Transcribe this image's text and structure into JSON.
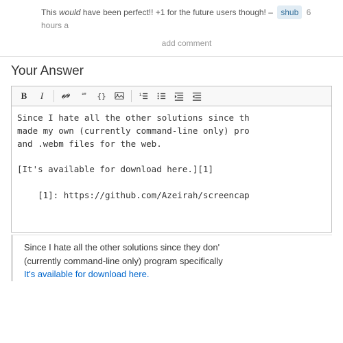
{
  "comment": {
    "text_prefix": "This ",
    "text_italic": "would",
    "text_suffix": " have been perfect!! +1 for the future users though! –",
    "username": "shub",
    "time": "6 hours a",
    "add_comment_label": "add comment"
  },
  "answer_section": {
    "title": "Your Answer",
    "toolbar": {
      "bold_label": "B",
      "italic_label": "I",
      "buttons": [
        "B",
        "I",
        "🔗",
        "\"\"",
        "{}",
        "🖼",
        "1.",
        "•",
        "≡",
        "≡≡"
      ]
    },
    "editor_content_line1": "Since I hate all the other solutions since th",
    "editor_content_line2": "made my own (currently command-line only) pro",
    "editor_content_line3": "and .webm files for the web.",
    "editor_content_line4": "",
    "editor_content_line5": "[It's available for download here.][1]",
    "editor_content_line6": "",
    "editor_content_line7": "    [1]: https://github.com/Azeirah/screencap"
  },
  "preview": {
    "line1_prefix": "Since I hate all the other solutions since they don'",
    "line2": "(currently command-line only) program specifically",
    "line3": "It's available for download here."
  },
  "colors": {
    "username_bg": "#e1ecf4",
    "username_text": "#39739d",
    "link_color": "#06c",
    "border_color": "#c0c0c0",
    "preview_border": "#ddd"
  }
}
